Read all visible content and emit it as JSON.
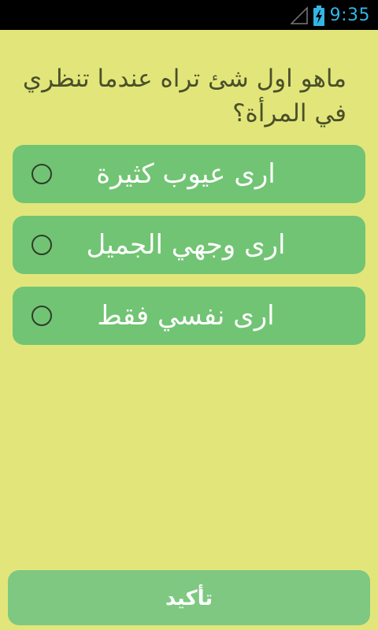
{
  "status_bar": {
    "time": "9:35",
    "icons": [
      "signal-icon",
      "battery-charging-icon"
    ],
    "time_color": "#33b5e5"
  },
  "question": {
    "text": "ماهو اول شئ تراه عندما تنظري في المرأة؟"
  },
  "options": [
    {
      "label": "ارى عيوب كثيرة",
      "selected": false
    },
    {
      "label": "ارى وجهي الجميل",
      "selected": false
    },
    {
      "label": "ارى نفسي فقط",
      "selected": false
    }
  ],
  "confirm_button": {
    "label": "تأكيد"
  },
  "colors": {
    "background": "#e2e67a",
    "option_background": "#71c473",
    "confirm_background": "#7ec882",
    "question_text": "#4a4f2a"
  }
}
